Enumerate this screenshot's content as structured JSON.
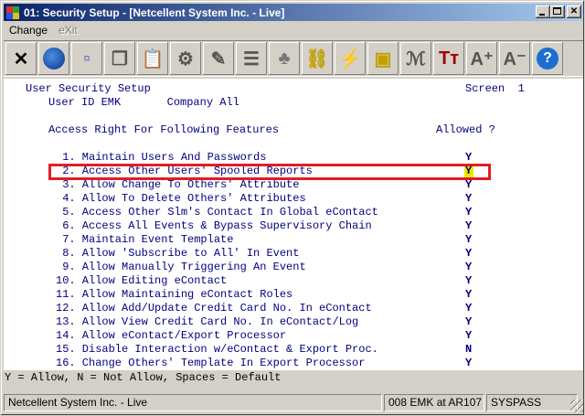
{
  "window": {
    "title": "01: Security Setup - [Netcellent System Inc. - Live]"
  },
  "menu": [
    {
      "label": "Change",
      "enabled": true
    },
    {
      "label": "eXit",
      "enabled": false
    }
  ],
  "toolbar": [
    {
      "icon": "scissors-x-icon",
      "glyph": "✕"
    },
    {
      "icon": "globe-icon",
      "glyph": "●"
    },
    {
      "icon": "select-rect-icon",
      "glyph": "▫"
    },
    {
      "icon": "copy-pages-icon",
      "glyph": "❐"
    },
    {
      "icon": "paste-clipboard-icon",
      "glyph": "📋"
    },
    {
      "icon": "settings-gear-icon",
      "glyph": "⚙"
    },
    {
      "icon": "edit-pencil-icon",
      "glyph": "✎"
    },
    {
      "icon": "list-icon",
      "glyph": "☰"
    },
    {
      "icon": "people-icon",
      "glyph": "♣"
    },
    {
      "icon": "chain-link-icon",
      "glyph": "⛓"
    },
    {
      "icon": "lightning-icon",
      "glyph": "⚡"
    },
    {
      "icon": "window-bolt-icon",
      "glyph": "▣"
    },
    {
      "icon": "signature-icon",
      "glyph": "ℳ"
    },
    {
      "icon": "text-size-icon",
      "glyph": "Tт"
    },
    {
      "icon": "font-increase-icon",
      "glyph": "A⁺"
    },
    {
      "icon": "font-decrease-icon",
      "glyph": "A⁻"
    },
    {
      "icon": "help-icon",
      "glyph": "?"
    }
  ],
  "screen": {
    "heading": "User Security Setup",
    "screen_label": "Screen  1",
    "user_line": "User ID EMK       Company All",
    "section_title": "Access Right For Following Features",
    "allowed_header": "Allowed ?",
    "items": [
      {
        "label": " 1. Maintain Users And Passwords",
        "allowed": "Y"
      },
      {
        "label": " 2. Access Other Users' Spooled Reports",
        "allowed": "Y"
      },
      {
        "label": " 3. Allow Change To Others' Attribute",
        "allowed": "Y"
      },
      {
        "label": " 4. Allow To Delete Others' Attributes",
        "allowed": "Y"
      },
      {
        "label": " 5. Access Other Slm's Contact In Global eContact",
        "allowed": "Y"
      },
      {
        "label": " 6. Access All Events & Bypass Supervisory Chain",
        "allowed": "Y"
      },
      {
        "label": " 7. Maintain Event Template",
        "allowed": "Y"
      },
      {
        "label": " 8. Allow 'Subscribe to All' In Event",
        "allowed": "Y"
      },
      {
        "label": " 9. Allow Manually Triggering An Event",
        "allowed": "Y"
      },
      {
        "label": "10. Allow Editing eContact",
        "allowed": "Y"
      },
      {
        "label": "11. Allow Maintaining eContact Roles",
        "allowed": "Y"
      },
      {
        "label": "12. Allow Add/Update Credit Card No. In eContact",
        "allowed": "Y"
      },
      {
        "label": "13. Allow View Credit Card No. In eContact/Log",
        "allowed": "Y"
      },
      {
        "label": "14. Allow eContact/Export Processor",
        "allowed": "Y"
      },
      {
        "label": "15. Disable Interaction w/eContact & Export Proc.",
        "allowed": "N"
      },
      {
        "label": "16. Change Others' Template In Export Processor",
        "allowed": "Y"
      }
    ],
    "legend": "Y = Allow, N = Not Allow, Spaces = Default"
  },
  "statusbar": {
    "company": "Netcellent System Inc. - Live",
    "session": "008 EMK at AR107",
    "mode": "SYSPASS"
  },
  "colors": {
    "highlight": "#e21d24",
    "terminal_text": "#000080",
    "cursor": "#e8e800"
  }
}
